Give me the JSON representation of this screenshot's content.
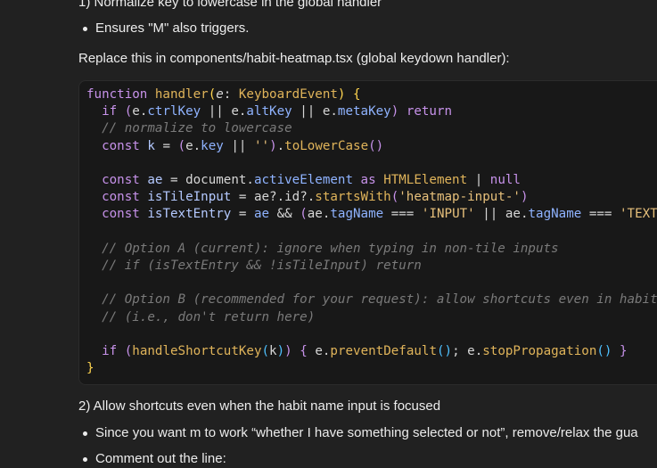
{
  "heading1": "1) Normalize key to lowercase in the global handler",
  "bullet1": "Ensures \"M\" also triggers.",
  "intro": "Replace this in components/habit-heatmap.tsx (global keydown handler):",
  "heading2": "2) Allow shortcuts even when the habit name input is focused",
  "bullet2": "Since you want m to work “whether I have something selected or not”, remove/relax the gua",
  "bullet3": "Comment out the line:",
  "code_lines": [
    "function handler(e: KeyboardEvent) {",
    "  if (e.ctrlKey || e.altKey || e.metaKey) return",
    "  // normalize to lowercase",
    "  const k = (e.key || '').toLowerCase()",
    "",
    "  const ae = document.activeElement as HTMLElement | null",
    "  const isTileInput = ae?.id?.startsWith('heatmap-input-')",
    "  const isTextEntry = ae && (ae.tagName === 'INPUT' || ae.tagName === 'TEXTAREA')",
    "",
    "  // Option A (current): ignore when typing in non-tile inputs",
    "  // if (isTextEntry && !isTileInput) return",
    "",
    "  // Option B (recommended for your request): allow shortcuts even in habit input",
    "  // (i.e., don't return here)",
    "",
    "  if (handleShortcutKey(k)) { e.preventDefault(); e.stopPropagation() }",
    "}"
  ]
}
